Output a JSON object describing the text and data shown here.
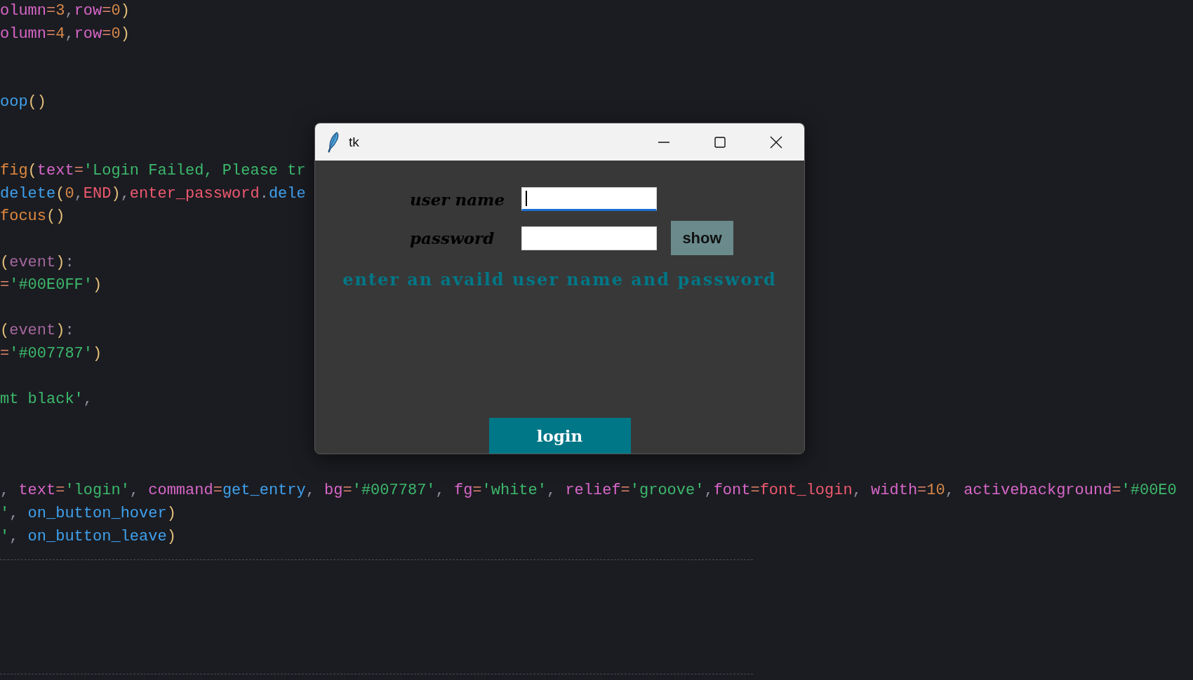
{
  "editor": {
    "lines": [
      {
        "kind": "code",
        "tokens": [
          {
            "text": "olumn",
            "kind": "param"
          },
          {
            "text": "=",
            "kind": "op"
          },
          {
            "text": "3",
            "kind": "num"
          },
          {
            "text": ",",
            "kind": "punct"
          },
          {
            "text": "row",
            "kind": "param"
          },
          {
            "text": "=",
            "kind": "op"
          },
          {
            "text": "0",
            "kind": "num"
          },
          {
            "text": ")",
            "kind": "paren"
          }
        ]
      },
      {
        "kind": "code",
        "tokens": [
          {
            "text": "olumn",
            "kind": "param"
          },
          {
            "text": "=",
            "kind": "op"
          },
          {
            "text": "4",
            "kind": "num"
          },
          {
            "text": ",",
            "kind": "punct"
          },
          {
            "text": "row",
            "kind": "param"
          },
          {
            "text": "=",
            "kind": "op"
          },
          {
            "text": "0",
            "kind": "num"
          },
          {
            "text": ")",
            "kind": "paren"
          }
        ]
      },
      {
        "kind": "blank"
      },
      {
        "kind": "blank"
      },
      {
        "kind": "code",
        "tokens": [
          {
            "text": "oop",
            "kind": "func"
          },
          {
            "text": "()",
            "kind": "paren"
          }
        ]
      },
      {
        "kind": "blank"
      },
      {
        "kind": "blank"
      },
      {
        "kind": "code",
        "tokens": [
          {
            "text": "fig",
            "kind": "method"
          },
          {
            "text": "(",
            "kind": "paren"
          },
          {
            "text": "text",
            "kind": "param"
          },
          {
            "text": "=",
            "kind": "op"
          },
          {
            "text": "'Login Failed, Please tr",
            "kind": "str"
          }
        ]
      },
      {
        "kind": "code",
        "tokens": [
          {
            "text": "delete",
            "kind": "func"
          },
          {
            "text": "(",
            "kind": "paren"
          },
          {
            "text": "0",
            "kind": "num"
          },
          {
            "text": ",",
            "kind": "punct"
          },
          {
            "text": "END",
            "kind": "const"
          },
          {
            "text": ")",
            "kind": "paren"
          },
          {
            "text": ",",
            "kind": "punct"
          },
          {
            "text": "enter_password",
            "kind": "const"
          },
          {
            "text": ".",
            "kind": "punct"
          },
          {
            "text": "dele",
            "kind": "func"
          }
        ]
      },
      {
        "kind": "code",
        "tokens": [
          {
            "text": "focus",
            "kind": "method"
          },
          {
            "text": "()",
            "kind": "paren"
          }
        ]
      },
      {
        "kind": "blank"
      },
      {
        "kind": "code",
        "tokens": [
          {
            "text": "(",
            "kind": "paren"
          },
          {
            "text": "event",
            "kind": "var"
          },
          {
            "text": ")",
            "kind": "paren"
          },
          {
            "text": ":",
            "kind": "punct"
          }
        ]
      },
      {
        "kind": "code",
        "tokens": [
          {
            "text": "=",
            "kind": "op"
          },
          {
            "text": "'#00E0FF'",
            "kind": "str"
          },
          {
            "text": ")",
            "kind": "paren"
          }
        ]
      },
      {
        "kind": "blank"
      },
      {
        "kind": "code",
        "tokens": [
          {
            "text": "(",
            "kind": "paren"
          },
          {
            "text": "event",
            "kind": "var"
          },
          {
            "text": ")",
            "kind": "paren"
          },
          {
            "text": ":",
            "kind": "punct"
          }
        ]
      },
      {
        "kind": "code",
        "tokens": [
          {
            "text": "=",
            "kind": "op"
          },
          {
            "text": "'#007787'",
            "kind": "str"
          },
          {
            "text": ")",
            "kind": "paren"
          }
        ]
      },
      {
        "kind": "blank"
      },
      {
        "kind": "code",
        "tokens": [
          {
            "text": "mt black'",
            "kind": "str"
          },
          {
            "text": ",",
            "kind": "punct"
          }
        ]
      },
      {
        "kind": "blank"
      },
      {
        "kind": "blank"
      },
      {
        "kind": "blank"
      },
      {
        "kind": "code",
        "tokens": [
          {
            "text": ", ",
            "kind": "punct"
          },
          {
            "text": "text",
            "kind": "param"
          },
          {
            "text": "=",
            "kind": "op"
          },
          {
            "text": "'login'",
            "kind": "str"
          },
          {
            "text": ", ",
            "kind": "punct"
          },
          {
            "text": "command",
            "kind": "param"
          },
          {
            "text": "=",
            "kind": "op"
          },
          {
            "text": "get_entry",
            "kind": "func"
          },
          {
            "text": ", ",
            "kind": "punct"
          },
          {
            "text": "bg",
            "kind": "param"
          },
          {
            "text": "=",
            "kind": "op"
          },
          {
            "text": "'#007787'",
            "kind": "str"
          },
          {
            "text": ", ",
            "kind": "punct"
          },
          {
            "text": "fg",
            "kind": "param"
          },
          {
            "text": "=",
            "kind": "op"
          },
          {
            "text": "'white'",
            "kind": "str"
          },
          {
            "text": ", ",
            "kind": "punct"
          },
          {
            "text": "relief",
            "kind": "param"
          },
          {
            "text": "=",
            "kind": "op"
          },
          {
            "text": "'groove'",
            "kind": "str"
          },
          {
            "text": ",",
            "kind": "punct"
          },
          {
            "text": "font",
            "kind": "param"
          },
          {
            "text": "=",
            "kind": "op"
          },
          {
            "text": "font_login",
            "kind": "const"
          },
          {
            "text": ", ",
            "kind": "punct"
          },
          {
            "text": "width",
            "kind": "param"
          },
          {
            "text": "=",
            "kind": "op"
          },
          {
            "text": "10",
            "kind": "num"
          },
          {
            "text": ", ",
            "kind": "punct"
          },
          {
            "text": "activebackground",
            "kind": "param"
          },
          {
            "text": "=",
            "kind": "op"
          },
          {
            "text": "'#00E0",
            "kind": "str"
          }
        ]
      },
      {
        "kind": "code",
        "tokens": [
          {
            "text": "'",
            "kind": "str"
          },
          {
            "text": ", ",
            "kind": "punct"
          },
          {
            "text": "on_button_hover",
            "kind": "func"
          },
          {
            "text": ")",
            "kind": "paren"
          }
        ]
      },
      {
        "kind": "code",
        "tokens": [
          {
            "text": "'",
            "kind": "str"
          },
          {
            "text": ", ",
            "kind": "punct"
          },
          {
            "text": "on_button_leave",
            "kind": "func"
          },
          {
            "text": ")",
            "kind": "paren"
          }
        ]
      },
      {
        "kind": "rule"
      },
      {
        "kind": "blank"
      },
      {
        "kind": "blank"
      },
      {
        "kind": "blank"
      },
      {
        "kind": "blank"
      },
      {
        "kind": "rule"
      }
    ]
  },
  "window": {
    "title": "tk",
    "fields": [
      {
        "label": "user name",
        "focused": true
      },
      {
        "label": "password",
        "focused": false
      }
    ],
    "show_button": "show",
    "message": "enter an availd user name and password",
    "login_button": "login"
  }
}
